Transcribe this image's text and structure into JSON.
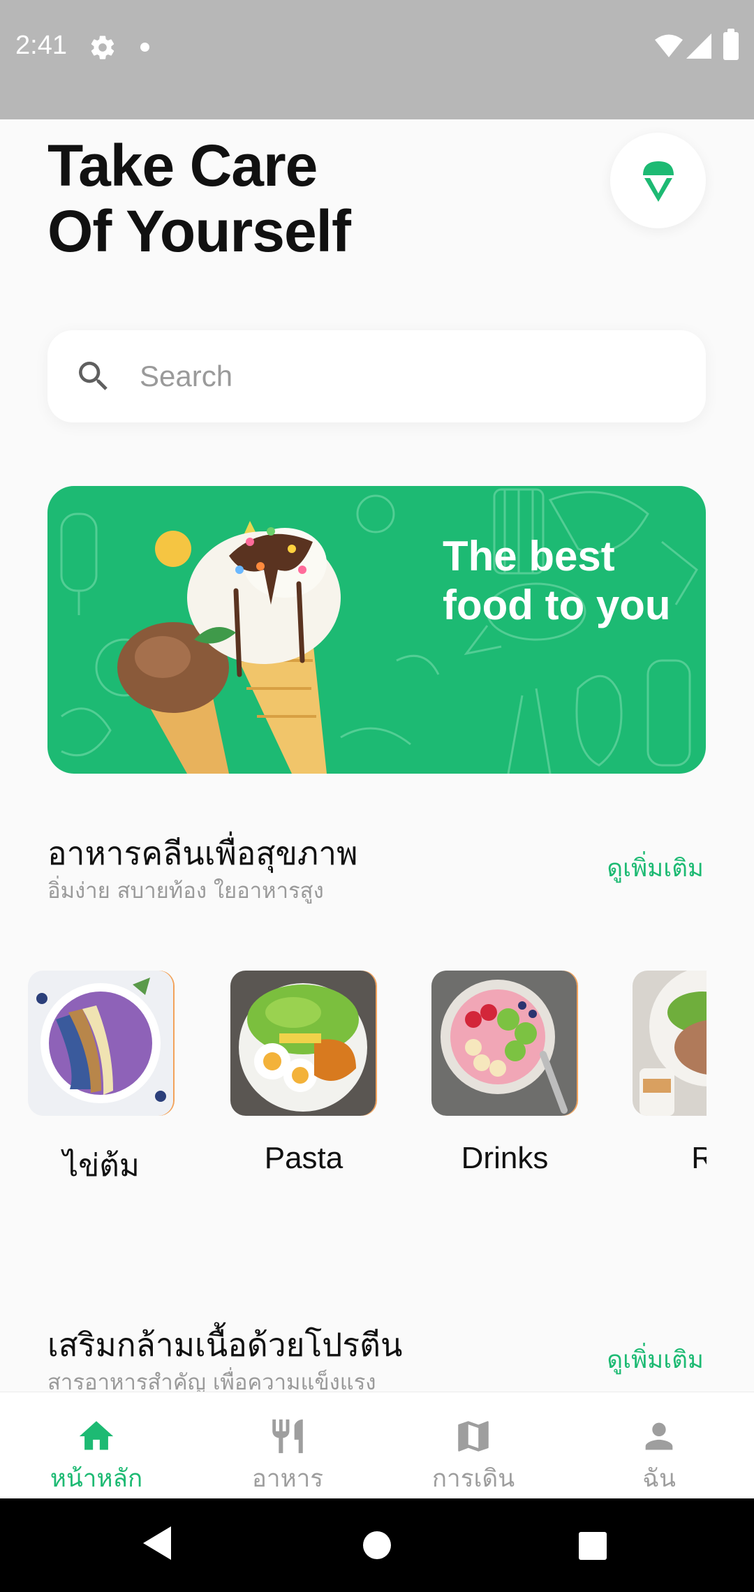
{
  "status_bar": {
    "time": "2:41",
    "icons": [
      "gear-icon",
      "notification-dot",
      "wifi-icon",
      "signal-icon",
      "battery-icon"
    ]
  },
  "header": {
    "title_line1": "Take Care",
    "title_line2": "Of Yourself",
    "action_icon": "ice-cream-icon"
  },
  "search": {
    "placeholder": "Search",
    "value": "",
    "icon": "search-icon"
  },
  "banner": {
    "line1": "The best",
    "line2": "food to you",
    "image": "ice-cream-cones"
  },
  "section1": {
    "title": "อาหารคลีนเพื่อสุขภาพ",
    "subtitle": "อิ่มง่าย สบายท้อง ใยอาหารสูง",
    "see_more": "ดูเพิ่มเติม"
  },
  "categories": [
    {
      "label": "ไข่ต้ม",
      "image": "acai-bowl"
    },
    {
      "label": "Pasta",
      "image": "salad-plate"
    },
    {
      "label": "Drinks",
      "image": "fruit-bowl"
    },
    {
      "label": "Ri",
      "image": "rice-dish"
    }
  ],
  "section2": {
    "title": "เสริมกล้ามเนื้อด้วยโปรตีน",
    "subtitle": "สารอาหารสำคัญ เพื่อความแข็งแรง",
    "see_more": "ดูเพิ่มเติม"
  },
  "bottom_nav": [
    {
      "label": "หน้าหลัก",
      "icon": "home-icon",
      "active": true
    },
    {
      "label": "อาหาร",
      "icon": "fork-knife-icon",
      "active": false
    },
    {
      "label": "การเดิน",
      "icon": "map-icon",
      "active": false
    },
    {
      "label": "ฉัน",
      "icon": "person-icon",
      "active": false
    }
  ],
  "colors": {
    "accent": "#1dba73",
    "background": "#fafafa",
    "status_bar": "#b7b7b7"
  }
}
